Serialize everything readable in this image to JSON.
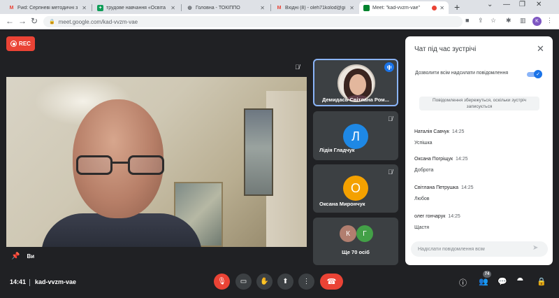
{
  "browser": {
    "tabs": [
      {
        "title": "Fwd: Серпневі методичні з",
        "favicon": "gmail-icon",
        "favicon_color": "#ea4335"
      },
      {
        "title": "трудове навчання «Освіта",
        "favicon": "sheets-icon",
        "favicon_color": "#0f9d58"
      },
      {
        "title": "Головна - ТОКІППО",
        "favicon": "globe-icon",
        "favicon_color": "#5f6368"
      },
      {
        "title": "Вхідні (8) - oleh71kolod@gi",
        "favicon": "gmail-icon",
        "favicon_color": "#ea4335"
      },
      {
        "title": "Meet: \"kad-vvzm-vae\"",
        "favicon": "meet-icon",
        "favicon_color": "#00832d"
      }
    ],
    "url": "meet.google.com/kad-vvzm-vae",
    "profile_initial": "K"
  },
  "meeting": {
    "rec_label": "REC",
    "self_label": "Ви",
    "time": "14:41",
    "code": "kad-vvzm-vae",
    "people_count": "74"
  },
  "participants": [
    {
      "name": "Демидась Світлана Ром...",
      "speaking": true
    },
    {
      "name": "Лідія Гладчук",
      "initial": "Л",
      "color": "#1e88e5"
    },
    {
      "name": "Оксана Мирончук",
      "initial": "О",
      "color": "#f4a100"
    },
    {
      "name": "Ще 70 осіб",
      "initials": [
        "К",
        "Г"
      ],
      "colors": [
        "#b17e6f",
        "#43a047"
      ]
    }
  ],
  "chat": {
    "title": "Чат під час зустрічі",
    "allow_label": "Дозволити всім надсилати повідомлення",
    "allow_on": true,
    "note": "Повідомлення збережуться, оскільки зустріч записується",
    "messages": [
      {
        "sender": "Наталія Савчук",
        "time": "14:25",
        "text": "Успішка"
      },
      {
        "sender": "Оксана Погріщук",
        "time": "14:25",
        "text": "Доброта"
      },
      {
        "sender": "Світлана Петрушка",
        "time": "14:25",
        "text": "Любов"
      },
      {
        "sender": "олег гончарук",
        "time": "14:25",
        "text": "Щастя"
      }
    ],
    "placeholder": "Надіслати повідомлення всім"
  }
}
